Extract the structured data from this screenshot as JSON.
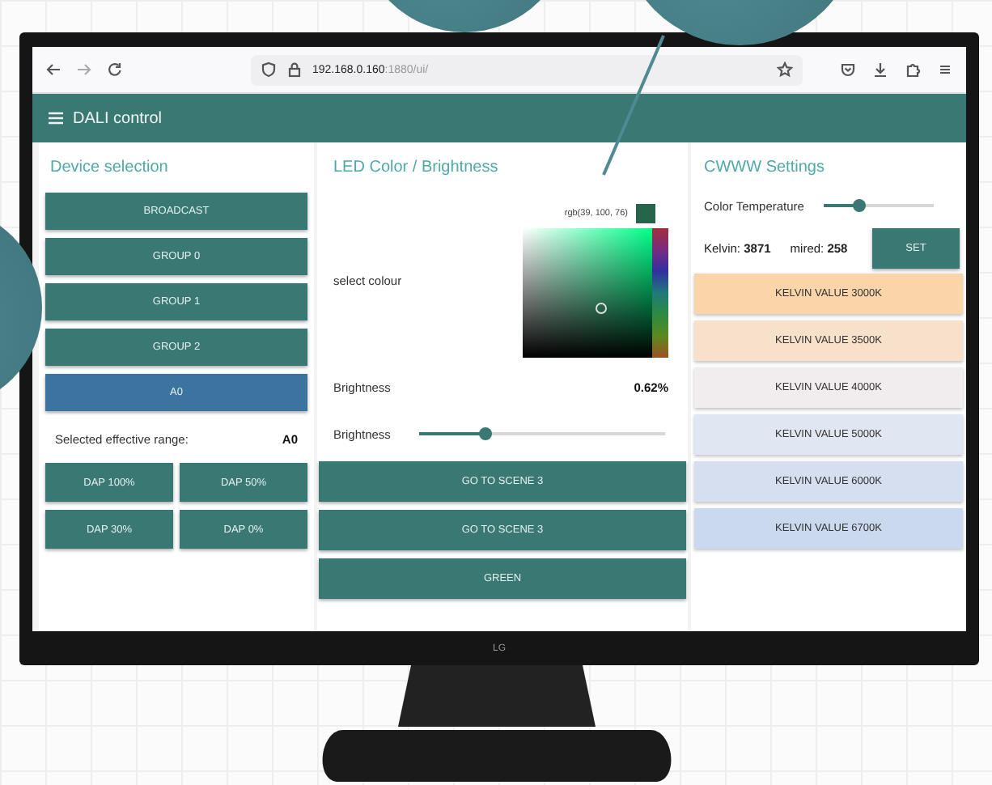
{
  "browser": {
    "address_host": "192.168.0.160",
    "address_path": ":1880/ui/"
  },
  "app_bar": {
    "title": "DALI control"
  },
  "device_selection": {
    "heading": "Device selection",
    "buttons": [
      {
        "label": "BROADCAST",
        "selected": false
      },
      {
        "label": "GROUP 0",
        "selected": false
      },
      {
        "label": "GROUP 1",
        "selected": false
      },
      {
        "label": "GROUP 2",
        "selected": false
      },
      {
        "label": "A0",
        "selected": true
      }
    ],
    "range_label": "Selected effective range:",
    "range_value": "A0",
    "dap_buttons": [
      "DAP 100%",
      "DAP 50%",
      "DAP 30%",
      "DAP 0%"
    ]
  },
  "led": {
    "heading": "LED Color / Brightness",
    "rgb_text": "rgb(39, 100, 76)",
    "select_label": "select colour",
    "brightness_label": "Brightness",
    "brightness_value": "0.62%",
    "slider": {
      "label": "Brightness",
      "level": 0.27
    },
    "scene_buttons": [
      "GO TO SCENE 3",
      "GO TO SCENE 3",
      "GREEN"
    ]
  },
  "cwww": {
    "heading": "CWWW Settings",
    "temperature": {
      "label": "Color Temperature",
      "level": 0.32
    },
    "kelvin": "Kelvin: **3871**",
    "mired": "mired: **258**",
    "set_button": "SET",
    "presets": [
      {
        "label": "KELVIN VALUE 3000K",
        "color": "#fbd5aa"
      },
      {
        "label": "KELVIN VALUE 3500K",
        "color": "#f8e1cb"
      },
      {
        "label": "KELVIN VALUE 4000K",
        "color": "#f1edef"
      },
      {
        "label": "KELVIN VALUE 5000K",
        "color": "#e1e6f3"
      },
      {
        "label": "KELVIN VALUE 6000K",
        "color": "#d5dff0"
      },
      {
        "label": "KELVIN VALUE 6700K",
        "color": "#cad9ee"
      }
    ]
  },
  "monitor": {
    "logo": "LG"
  }
}
